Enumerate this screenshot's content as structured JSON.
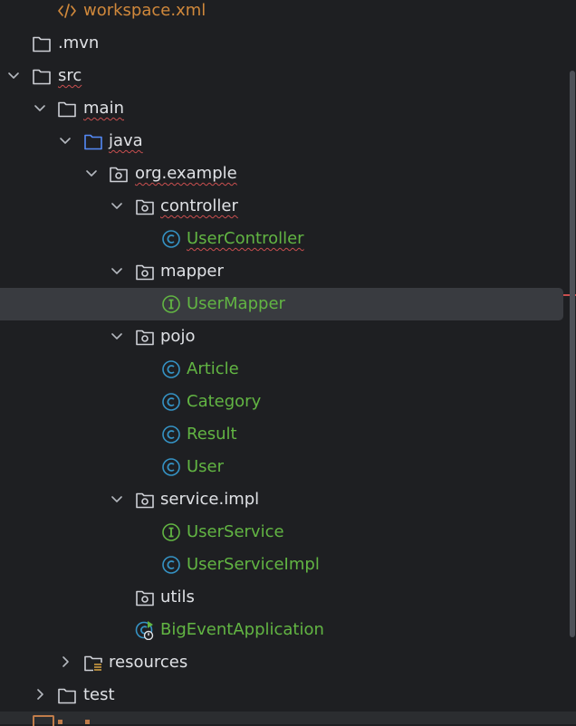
{
  "colors": {
    "background": "#1e1f22",
    "selection": "#393b40",
    "text": "#dfe1e5",
    "class_name": "#62b543",
    "xml_file": "#d0883b",
    "class_icon": "#3592c4",
    "interface_icon": "#62b543",
    "error_underline": "#c94f4f"
  },
  "tree": {
    "items": [
      {
        "label": "workspace.xml",
        "icon": "xml-icon"
      },
      {
        "label": ".mvn",
        "icon": "folder-icon"
      },
      {
        "label": "src",
        "icon": "folder-icon",
        "expanded": true
      },
      {
        "label": "main",
        "icon": "folder-icon",
        "expanded": true
      },
      {
        "label": "java",
        "icon": "source-folder-icon",
        "expanded": true
      },
      {
        "label": "org.example",
        "icon": "package-icon",
        "expanded": true
      },
      {
        "label": "controller",
        "icon": "package-icon",
        "expanded": true
      },
      {
        "label": "UserController",
        "icon": "class-icon"
      },
      {
        "label": "mapper",
        "icon": "package-icon",
        "expanded": true
      },
      {
        "label": "UserMapper",
        "icon": "interface-icon",
        "selected": true
      },
      {
        "label": "pojo",
        "icon": "package-icon",
        "expanded": true
      },
      {
        "label": "Article",
        "icon": "class-icon"
      },
      {
        "label": "Category",
        "icon": "class-icon"
      },
      {
        "label": "Result",
        "icon": "class-icon"
      },
      {
        "label": "User",
        "icon": "class-icon"
      },
      {
        "label": "service.impl",
        "icon": "package-icon",
        "expanded": true
      },
      {
        "label": "UserService",
        "icon": "interface-icon"
      },
      {
        "label": "UserServiceImpl",
        "icon": "class-icon"
      },
      {
        "label": "utils",
        "icon": "package-icon"
      },
      {
        "label": "BigEventApplication",
        "icon": "spring-boot-class-icon"
      },
      {
        "label": "resources",
        "icon": "resources-folder-icon",
        "expanded": false
      },
      {
        "label": "test",
        "icon": "folder-icon",
        "expanded": false
      }
    ]
  }
}
